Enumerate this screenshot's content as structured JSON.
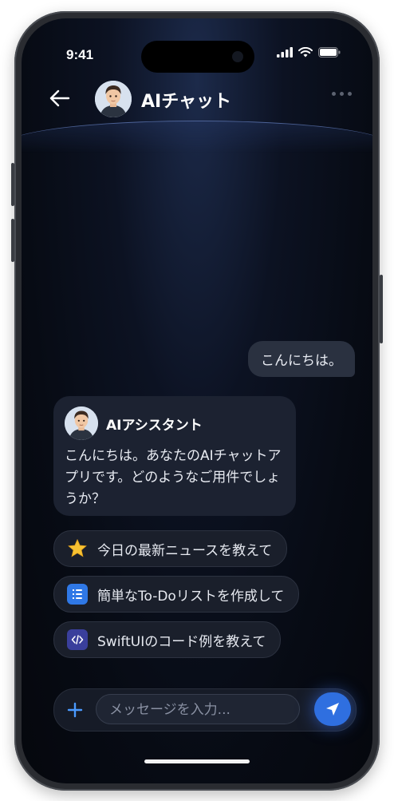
{
  "status_bar": {
    "time": "9:41"
  },
  "header": {
    "title": "AIチャット"
  },
  "messages": {
    "user": "こんにちは。",
    "ai_name": "AIアシスタント",
    "ai_text": "こんにちは。あなたのAIチャットアプリです。どのようなご用件でしょうか？"
  },
  "suggestions": [
    {
      "label": "今日の最新ニュースを教えて",
      "icon": "star-icon"
    },
    {
      "label": "簡単なTo-Doリストを作成して",
      "icon": "list-icon"
    },
    {
      "label": "SwiftUIのコード例を教えて",
      "icon": "code-icon"
    }
  ],
  "input": {
    "placeholder": "メッセージを入力..."
  },
  "colors": {
    "accent": "#2f6fe0",
    "background": "#070b14",
    "bubble": "#1c2231"
  }
}
